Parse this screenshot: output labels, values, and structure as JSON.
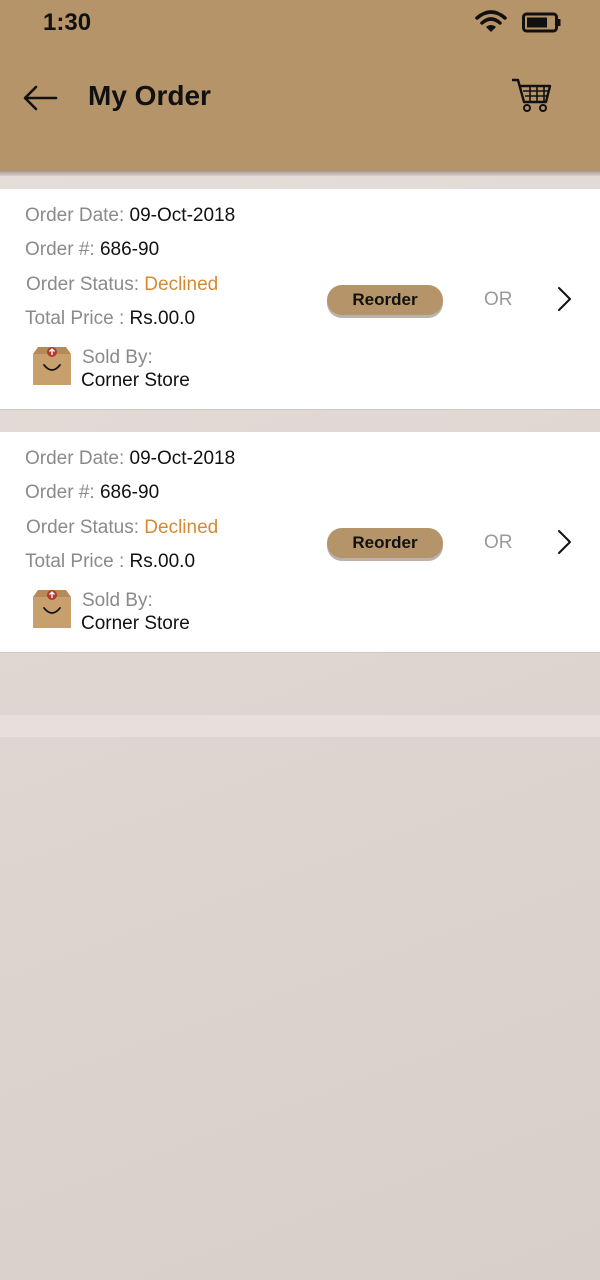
{
  "status_bar": {
    "time": "1:30"
  },
  "header": {
    "title": "My Order"
  },
  "orders": [
    {
      "date_label": "Order Date:",
      "date": "09-Oct-2018",
      "number_label": "Order #:",
      "number": "686-90",
      "status_label": "Order Status:",
      "status": "Declined",
      "price_label": "Total Price :",
      "price": "Rs.00.0",
      "sold_by_label": "Sold By:",
      "store": "Corner Store",
      "reorder_label": "Reorder",
      "or_label": "OR"
    },
    {
      "date_label": "Order Date:",
      "date": "09-Oct-2018",
      "number_label": "Order #:",
      "number": "686-90",
      "status_label": "Order Status:",
      "status": "Declined",
      "price_label": "Total Price :",
      "price": "Rs.00.0",
      "sold_by_label": "Sold By:",
      "store": "Corner Store",
      "reorder_label": "Reorder",
      "or_label": "OR"
    }
  ],
  "colors": {
    "accent": "#b59469",
    "status_declined": "#d48a35"
  },
  "icons": [
    "back-arrow-icon",
    "cart-icon",
    "wifi-icon",
    "battery-icon",
    "store-box-icon",
    "chevron-right-icon"
  ]
}
